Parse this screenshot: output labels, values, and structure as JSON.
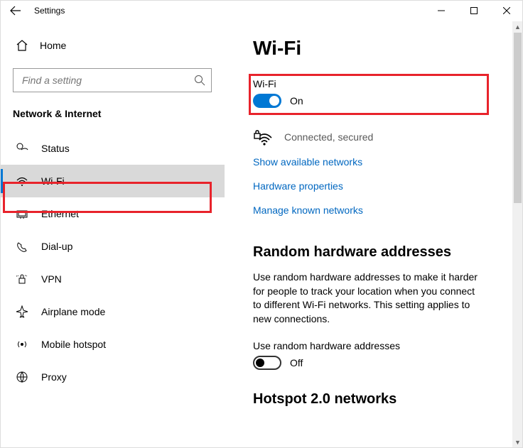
{
  "titlebar": {
    "title": "Settings"
  },
  "sidebar": {
    "home_label": "Home",
    "search_placeholder": "Find a setting",
    "category_header": "Network & Internet",
    "items": [
      {
        "label": "Status"
      },
      {
        "label": "Wi-Fi"
      },
      {
        "label": "Ethernet"
      },
      {
        "label": "Dial-up"
      },
      {
        "label": "VPN"
      },
      {
        "label": "Airplane mode"
      },
      {
        "label": "Mobile hotspot"
      },
      {
        "label": "Proxy"
      }
    ]
  },
  "page": {
    "title": "Wi-Fi",
    "wifi_section_label": "Wi-Fi",
    "wifi_toggle": {
      "state": "On",
      "on": true
    },
    "status_text": "Connected, secured",
    "links": {
      "show_networks": "Show available networks",
      "hardware_properties": "Hardware properties",
      "manage_networks": "Manage known networks"
    },
    "random_hw": {
      "heading": "Random hardware addresses",
      "description": "Use random hardware addresses to make it harder for people to track your location when you connect to different Wi-Fi networks. This setting applies to new connections.",
      "toggle_label": "Use random hardware addresses",
      "toggle_state": "Off"
    },
    "hotspot_heading": "Hotspot 2.0 networks"
  }
}
